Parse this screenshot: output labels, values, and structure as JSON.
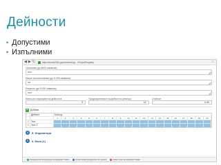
{
  "slide": {
    "title": "Дейности",
    "bullets": [
      "Допустими",
      "Изпълними"
    ]
  },
  "browser": {
    "url": "https://eumis2020.government.bg/…/ProjectProgress"
  },
  "form": {
    "fields": [
      {
        "label": "Описание (до 5000 символа)",
        "value": "тест"
      },
      {
        "label": "Начин на изпълнение (до 5 000 символа)",
        "value": "тот"
      },
      {
        "label": "Резултат (до 5 000 символа)",
        "value": "тест"
      }
    ],
    "numbers": [
      {
        "label": "Месец на стартиране на дейността",
        "value": "5"
      },
      {
        "label": "Продължителност на дейността (месеци)",
        "value": "12"
      },
      {
        "label": "Стойност",
        "value": "0.00"
      }
    ]
  },
  "add_label": "Добави",
  "grid": {
    "header_activity": "Дейност",
    "header_month": "Месеци",
    "weeks": [
      "1",
      "2",
      "3",
      "4",
      "5",
      "6",
      "7",
      "8",
      "9",
      "10",
      "11",
      "12",
      "13",
      "14",
      "15",
      "16",
      "17",
      "18",
      "19",
      "20"
    ],
    "rows": [
      {
        "num": "1",
        "name": "Тест",
        "filled": [
          true,
          true,
          true,
          true,
          true,
          true,
          true,
          true,
          true,
          true,
          true,
          true,
          true,
          true,
          true,
          true,
          true,
          true,
          true,
          true
        ]
      },
      {
        "num": "2",
        "name": "Тест 2",
        "filled": [
          true,
          true,
          true,
          true,
          true,
          true,
          true,
          true,
          true,
          true,
          true,
          true,
          true,
          true,
          true,
          true,
          true,
          true,
          true,
          true
        ]
      }
    ]
  },
  "sections": [
    {
      "num": "8",
      "title": "8. Индикатори"
    },
    {
      "num": "9",
      "title": "9. Екип (1)"
    }
  ],
  "footer": [
    {
      "label": "Проверка на формуляра за кандидатстване",
      "color": "#3aa53a"
    },
    {
      "label": "Принтиране формуляра за грешки",
      "color": "#2a6fb0"
    },
    {
      "label": "Краен срок за кандидатстване",
      "color": "#d04a3a"
    }
  ]
}
